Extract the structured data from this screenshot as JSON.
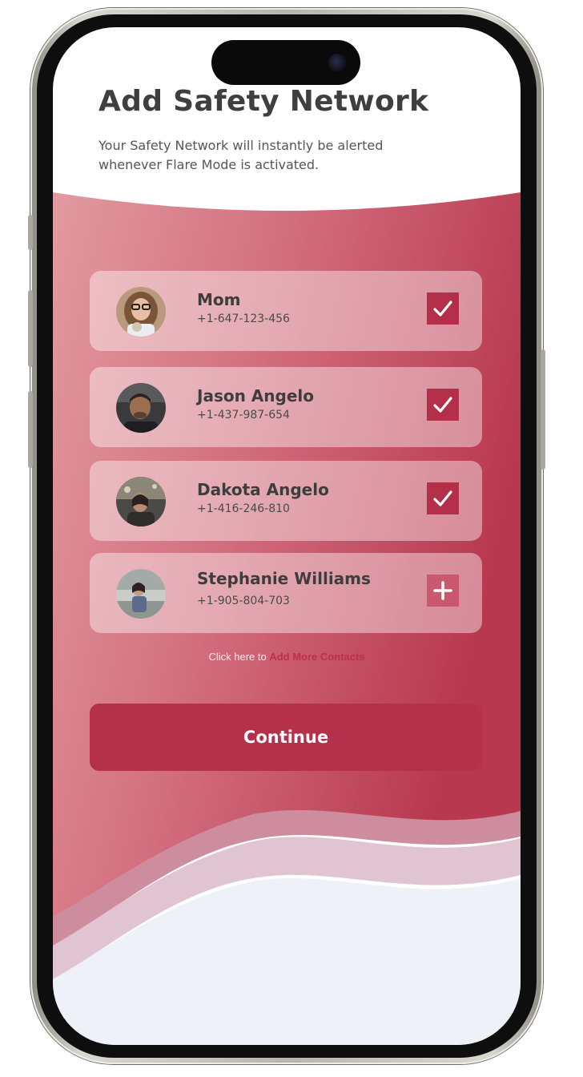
{
  "header": {
    "title": "Add Safety Network",
    "subtitle": "Your Safety Network will instantly be alerted whenever Flare Mode is activated."
  },
  "contacts": [
    {
      "name": "Mom",
      "phone": "+1-647-123-456",
      "selected": true,
      "action_icon": "check-icon"
    },
    {
      "name": "Jason Angelo",
      "phone": "+1-437-987-654",
      "selected": true,
      "action_icon": "check-icon"
    },
    {
      "name": "Dakota Angelo",
      "phone": "+1-416-246-810",
      "selected": true,
      "action_icon": "check-icon"
    },
    {
      "name": "Stephanie Williams",
      "phone": "+1-905-804-703",
      "selected": false,
      "action_icon": "plus-icon"
    }
  ],
  "add_more": {
    "prefix": "Click here to",
    "link_label": "Add More Contacts"
  },
  "continue_label": "Continue",
  "colors": {
    "accent": "#b5304a",
    "gradient_light": "#e9a2a7",
    "gradient_dark": "#b8384f",
    "footer_bg": "#eef2f8",
    "title_text": "#3f3f3f"
  }
}
